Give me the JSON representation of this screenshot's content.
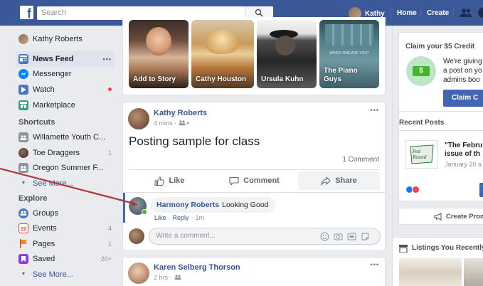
{
  "topbar": {
    "search_placeholder": "Search",
    "profile_name": "Kathy",
    "home": "Home",
    "create": "Create"
  },
  "left_nav": {
    "profile": "Kathy Roberts",
    "news_feed": "News Feed",
    "news_feed_more": "•••",
    "messenger": "Messenger",
    "watch": "Watch",
    "marketplace": "Marketplace",
    "shortcuts_heading": "Shortcuts",
    "shortcuts": [
      {
        "label": "Willamette Youth C...",
        "count": ""
      },
      {
        "label": "Toe Draggers",
        "count": "1"
      },
      {
        "label": "Oregon Summer F...",
        "count": ""
      }
    ],
    "see_more_1": "See More...",
    "explore_heading": "Explore",
    "explore": [
      {
        "label": "Groups",
        "count": ""
      },
      {
        "label": "Events",
        "count": "4"
      },
      {
        "label": "Pages",
        "count": "1"
      },
      {
        "label": "Saved",
        "count": "20+"
      }
    ],
    "events_day": "22",
    "see_more_2": "See More..."
  },
  "stories": [
    {
      "label": "Add to Story"
    },
    {
      "label": "Cathy Houston"
    },
    {
      "label": "Ursula Kuhn"
    },
    {
      "label": "The Piano Guys",
      "sign": "WHICH ONE ARE YOU?"
    }
  ],
  "post1": {
    "author": "Kathy Roberts",
    "time": "4 mins ·",
    "text": "Posting sample for class",
    "comment_count": "1 Comment",
    "like": "Like",
    "comment": "Comment",
    "share": "Share",
    "more": "•••"
  },
  "comment": {
    "author": "Harmony Roberts",
    "text": "Looking Good",
    "like": "Like",
    "reply": "Reply",
    "time": "1m",
    "dot1": "·",
    "dot2": "·"
  },
  "write_comment": {
    "placeholder": "Write a comment..."
  },
  "post2": {
    "author": "Karen Selberg Thorson",
    "time": "2 hrs ·",
    "more": "•••"
  },
  "right_col": {
    "claim_title": "Claim your $5 Credit",
    "claim_text_1": "We're giving",
    "claim_text_2": "a post on yo",
    "claim_text_3": "admins boo",
    "claim_button": "Claim C",
    "recent_posts": "Recent Posts",
    "recent_title_1": "\"The Febru",
    "recent_title_2": "issue of th",
    "recent_date": "January 20 a",
    "create_promo": "Create Prom",
    "listings": "Listings You Recently"
  },
  "colors": {
    "brand": "#3b5998",
    "link": "#365899",
    "online": "#42b72a",
    "annotation": "#b03a3a"
  }
}
